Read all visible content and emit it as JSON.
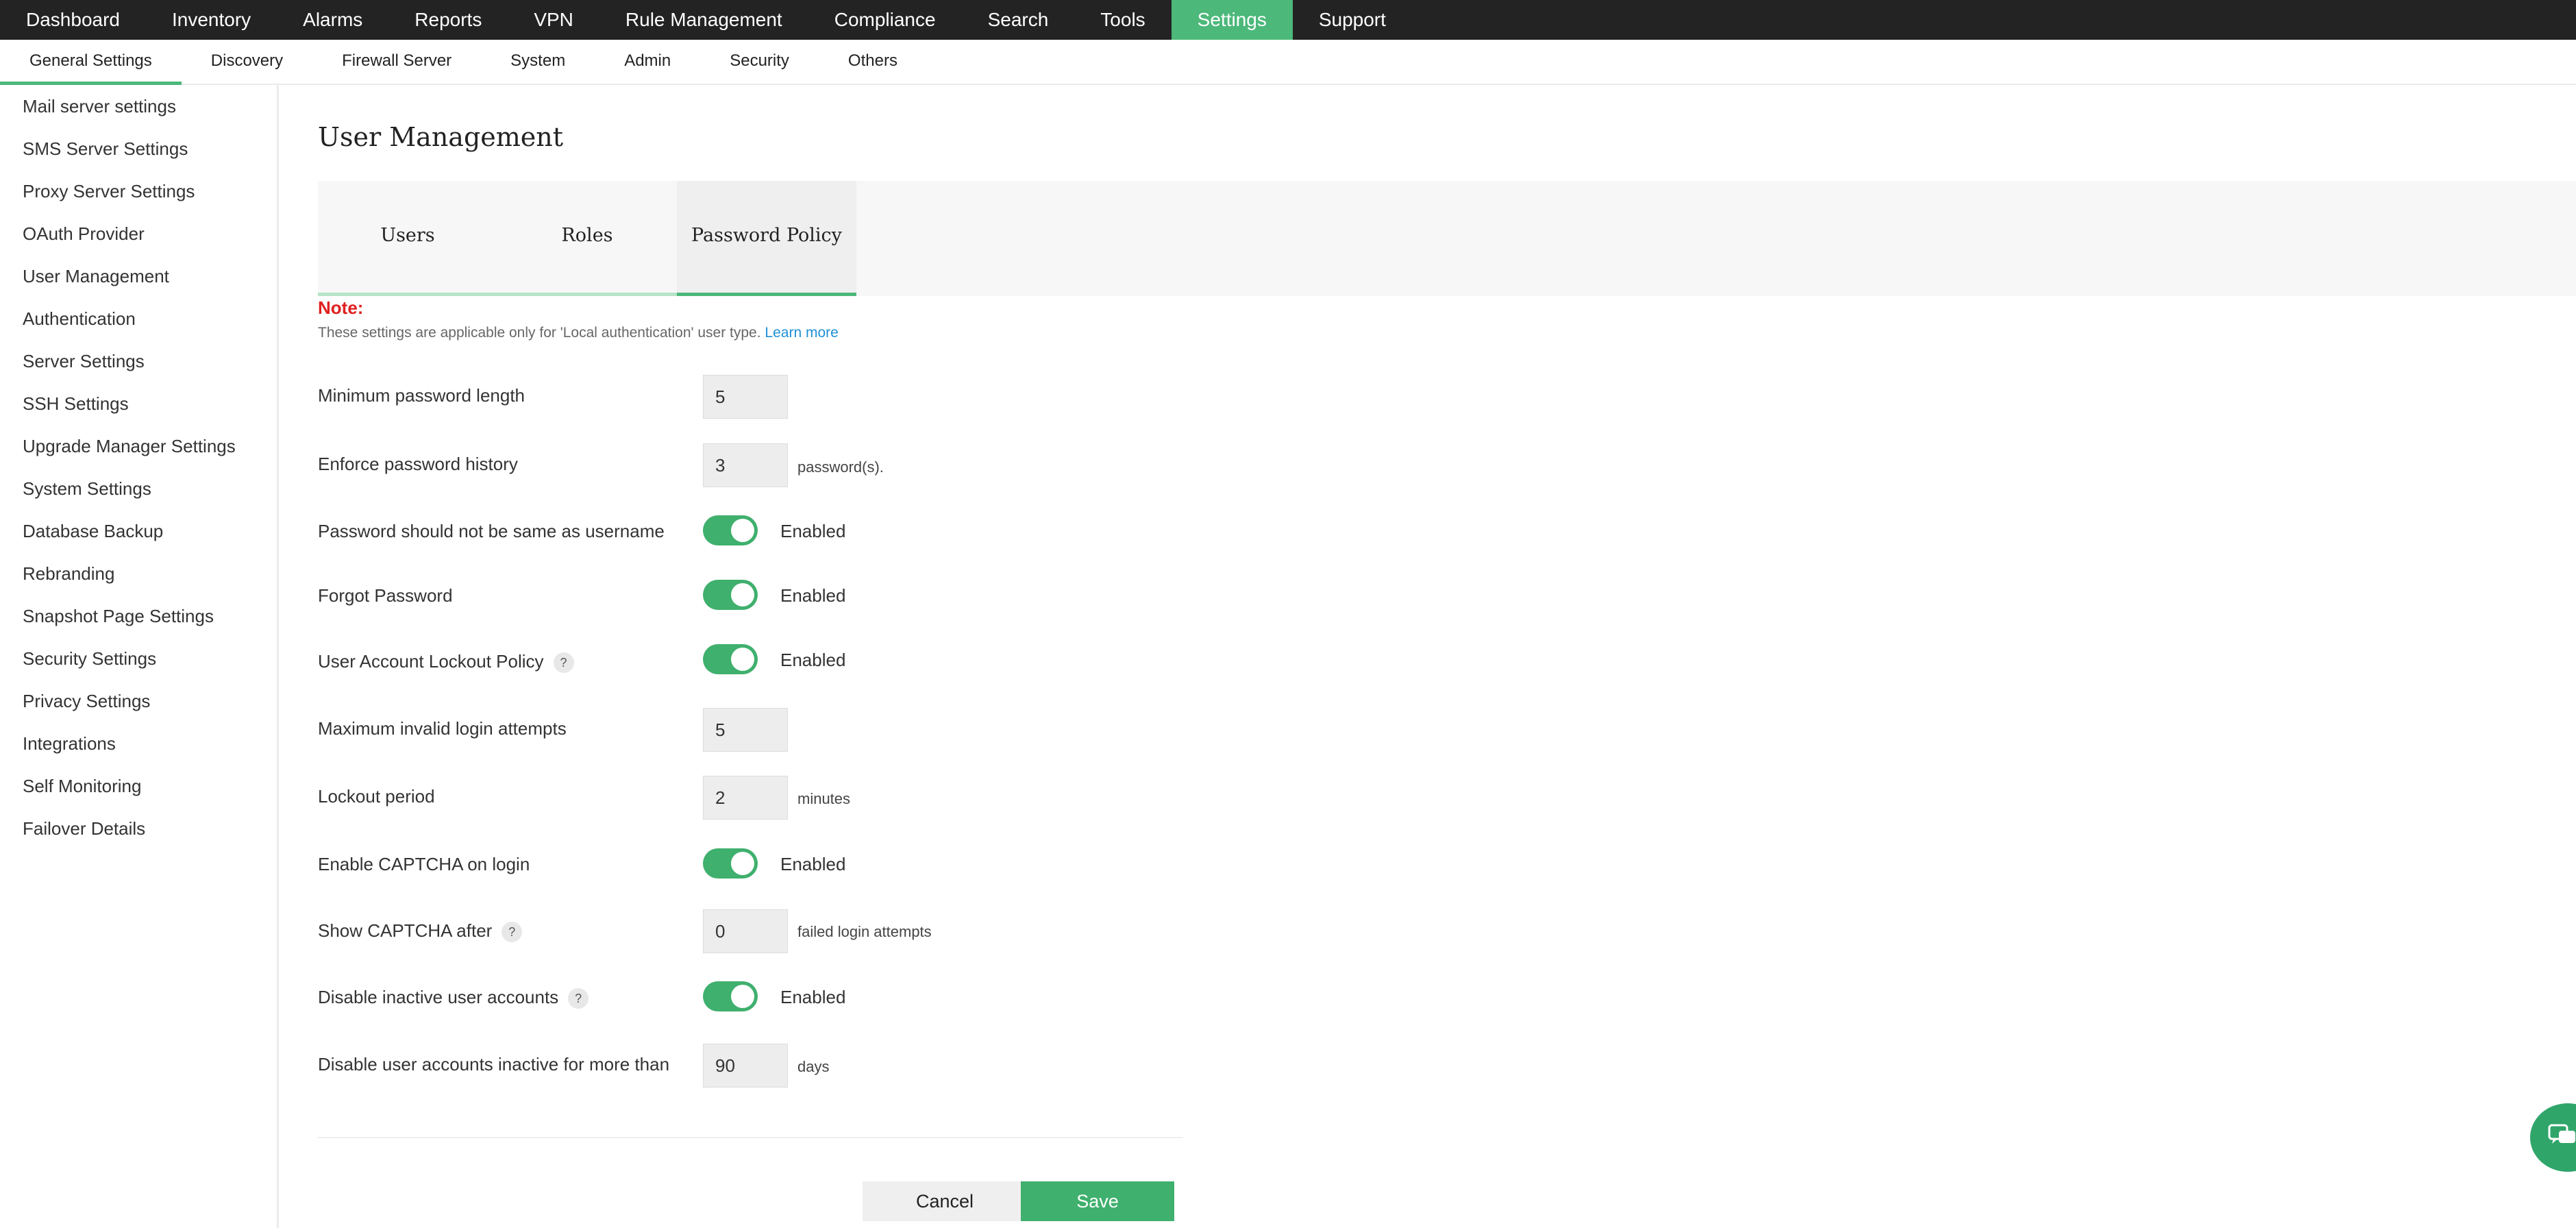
{
  "topnav": {
    "items": [
      "Dashboard",
      "Inventory",
      "Alarms",
      "Reports",
      "VPN",
      "Rule Management",
      "Compliance",
      "Search",
      "Tools",
      "Settings",
      "Support"
    ],
    "active": "Settings"
  },
  "subnav": {
    "items": [
      "General Settings",
      "Discovery",
      "Firewall Server",
      "System",
      "Admin",
      "Security",
      "Others"
    ],
    "active": "General Settings"
  },
  "sidebar": {
    "items": [
      "Mail server settings",
      "SMS Server Settings",
      "Proxy Server Settings",
      "OAuth Provider",
      "User Management",
      "Authentication",
      "Server Settings",
      "SSH Settings",
      "Upgrade Manager Settings",
      "System Settings",
      "Database Backup",
      "Rebranding",
      "Snapshot Page Settings",
      "Security Settings",
      "Privacy Settings",
      "Integrations",
      "Self Monitoring",
      "Failover Details"
    ]
  },
  "page": {
    "title": "User Management",
    "tabs": [
      "Users",
      "Roles",
      "Password Policy"
    ],
    "active_tab": "Password Policy"
  },
  "note": {
    "label": "Note:",
    "text": "These settings are applicable only for 'Local authentication' user type.",
    "link": "Learn more"
  },
  "form": {
    "min_length": {
      "label": "Minimum password length",
      "value": "5"
    },
    "history": {
      "label": "Enforce password history",
      "value": "3",
      "suffix": "password(s)."
    },
    "not_same_username": {
      "label": "Password should not be same as username",
      "status": "Enabled"
    },
    "forgot_password": {
      "label": "Forgot Password",
      "status": "Enabled"
    },
    "lockout_policy": {
      "label": "User Account Lockout Policy",
      "help": "?",
      "status": "Enabled"
    },
    "max_attempts": {
      "label": "Maximum invalid login attempts",
      "value": "5"
    },
    "lockout_period": {
      "label": "Lockout period",
      "value": "2",
      "suffix": "minutes"
    },
    "captcha": {
      "label": "Enable CAPTCHA on login",
      "status": "Enabled"
    },
    "captcha_after": {
      "label": "Show CAPTCHA after",
      "help": "?",
      "value": "0",
      "suffix": "failed login attempts"
    },
    "disable_inactive": {
      "label": "Disable inactive user accounts",
      "help": "?",
      "status": "Enabled"
    },
    "inactive_days": {
      "label": "Disable user accounts inactive for more than",
      "value": "90",
      "suffix": "days"
    }
  },
  "buttons": {
    "cancel": "Cancel",
    "save": "Save"
  },
  "colors": {
    "accent": "#4cb87a",
    "toggle": "#3fb06d",
    "note": "#e02020",
    "link": "#1e90d6",
    "topbar": "#232323"
  },
  "icons": {
    "chat": "chat-icon",
    "help": "help-icon"
  }
}
